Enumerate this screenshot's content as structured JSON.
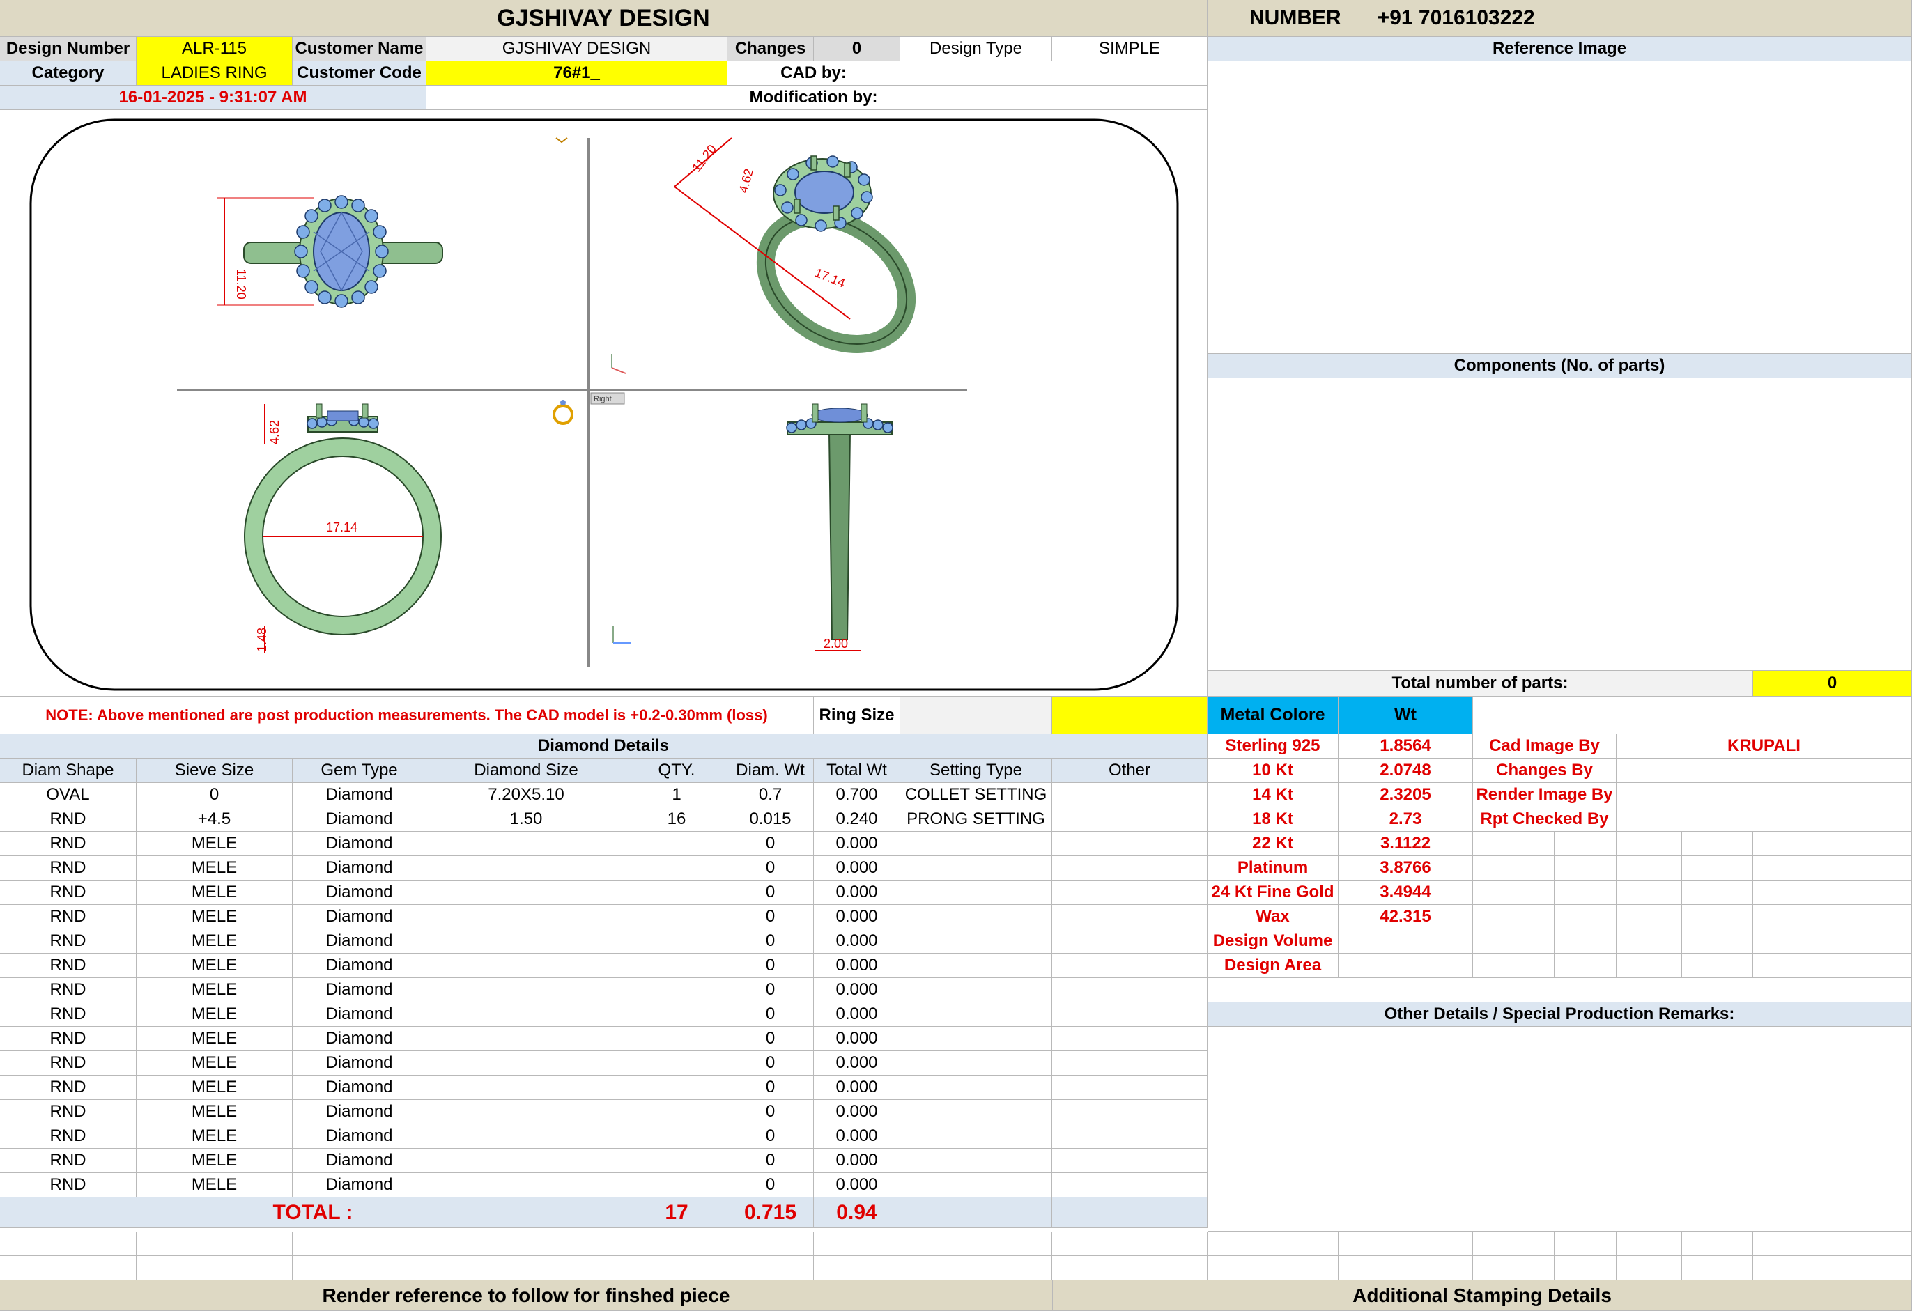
{
  "header": {
    "company": "GJSHIVAY DESIGN",
    "number_label": "NUMBER",
    "phone": "+91 7016103222"
  },
  "info": {
    "design_number_label": "Design Number",
    "design_number": "ALR-115",
    "customer_name_label": "Customer Name",
    "customer_name": "GJSHIVAY DESIGN",
    "changes_label": "Changes",
    "changes": "0",
    "design_type_label": "Design Type",
    "design_type": "SIMPLE",
    "category_label": "Category",
    "category": "LADIES RING",
    "customer_code_label": "Customer Code",
    "customer_code": "76#1_",
    "cad_by_label": "CAD by:",
    "modification_by_label": "Modification by:",
    "timestamp": "16-01-2025 - 9:31:07 AM"
  },
  "right_panel": {
    "reference_image_label": "Reference Image",
    "components_label": "Components (No. of parts)",
    "total_parts_label": "Total number of parts:",
    "total_parts": "0",
    "other_details_label": "Other Details / Special Production Remarks:"
  },
  "drawing": {
    "dim_height": "11.20",
    "dim_top_diag": "11.20",
    "dim_height_side": "4.62",
    "dim_length_diag": "17.14",
    "dim_inner": "17.14",
    "dim_shank": "1.48",
    "dim_width": "2.00",
    "view_label": "Right"
  },
  "note": {
    "text": "NOTE: Above mentioned are post production measurements. The CAD model is +0.2-0.30mm (loss)",
    "ring_size_label": "Ring Size",
    "ring_size": ""
  },
  "diamond": {
    "title": "Diamond Details",
    "headers": [
      "Diam Shape",
      "Sieve Size",
      "Gem Type",
      "Diamond Size",
      "QTY.",
      "Diam. Wt",
      "Total Wt",
      "Setting Type",
      "Other"
    ],
    "rows": [
      [
        "OVAL",
        "0",
        "Diamond",
        "7.20X5.10",
        "1",
        "0.7",
        "0.700",
        "COLLET SETTING",
        ""
      ],
      [
        "RND",
        "+4.5",
        "Diamond",
        "1.50",
        "16",
        "0.015",
        "0.240",
        "PRONG SETTING",
        ""
      ],
      [
        "RND",
        "MELE",
        "Diamond",
        "",
        "",
        "0",
        "0.000",
        "",
        ""
      ],
      [
        "RND",
        "MELE",
        "Diamond",
        "",
        "",
        "0",
        "0.000",
        "",
        ""
      ],
      [
        "RND",
        "MELE",
        "Diamond",
        "",
        "",
        "0",
        "0.000",
        "",
        ""
      ],
      [
        "RND",
        "MELE",
        "Diamond",
        "",
        "",
        "0",
        "0.000",
        "",
        ""
      ],
      [
        "RND",
        "MELE",
        "Diamond",
        "",
        "",
        "0",
        "0.000",
        "",
        ""
      ],
      [
        "RND",
        "MELE",
        "Diamond",
        "",
        "",
        "0",
        "0.000",
        "",
        ""
      ],
      [
        "RND",
        "MELE",
        "Diamond",
        "",
        "",
        "0",
        "0.000",
        "",
        ""
      ],
      [
        "RND",
        "MELE",
        "Diamond",
        "",
        "",
        "0",
        "0.000",
        "",
        ""
      ],
      [
        "RND",
        "MELE",
        "Diamond",
        "",
        "",
        "0",
        "0.000",
        "",
        ""
      ],
      [
        "RND",
        "MELE",
        "Diamond",
        "",
        "",
        "0",
        "0.000",
        "",
        ""
      ],
      [
        "RND",
        "MELE",
        "Diamond",
        "",
        "",
        "0",
        "0.000",
        "",
        ""
      ],
      [
        "RND",
        "MELE",
        "Diamond",
        "",
        "",
        "0",
        "0.000",
        "",
        ""
      ],
      [
        "RND",
        "MELE",
        "Diamond",
        "",
        "",
        "0",
        "0.000",
        "",
        ""
      ],
      [
        "RND",
        "MELE",
        "Diamond",
        "",
        "",
        "0",
        "0.000",
        "",
        ""
      ],
      [
        "RND",
        "MELE",
        "Diamond",
        "",
        "",
        "0",
        "0.000",
        "",
        ""
      ]
    ],
    "total_label": "TOTAL :",
    "total_qty": "17",
    "total_diam_wt": "0.715",
    "total_wt": "0.94"
  },
  "metal": {
    "header_label": "Metal Colore",
    "wt_label": "Wt",
    "rows": [
      {
        "name": "Sterling 925",
        "wt": "1.8564"
      },
      {
        "name": "10 Kt",
        "wt": "2.0748"
      },
      {
        "name": "14 Kt",
        "wt": "2.3205"
      },
      {
        "name": "18 Kt",
        "wt": "2.73"
      },
      {
        "name": "22 Kt",
        "wt": "3.1122"
      },
      {
        "name": "Platinum",
        "wt": "3.8766"
      },
      {
        "name": "24 Kt Fine Gold",
        "wt": "3.4944"
      },
      {
        "name": "Wax",
        "wt": "42.315"
      },
      {
        "name": "Design Volume",
        "wt": ""
      },
      {
        "name": "Design Area",
        "wt": ""
      }
    ]
  },
  "credits": [
    {
      "label": "Cad Image By",
      "value": "KRUPALI"
    },
    {
      "label": "Changes By",
      "value": ""
    },
    {
      "label": "Render Image By",
      "value": ""
    },
    {
      "label": "Rpt Checked By",
      "value": ""
    }
  ],
  "footer": {
    "render_reference": "Render reference to follow for finshed piece",
    "stamping": "Additional Stamping Details"
  },
  "colors": {
    "highlight_yellow": "#ffff00",
    "header_tan": "#ded9c4",
    "header_blue": "#dce6f1",
    "cyan": "#00b0f0",
    "red_text": "#e00000",
    "metal_green": "#8fbf8f",
    "stone_blue": "#7f9fe0"
  }
}
